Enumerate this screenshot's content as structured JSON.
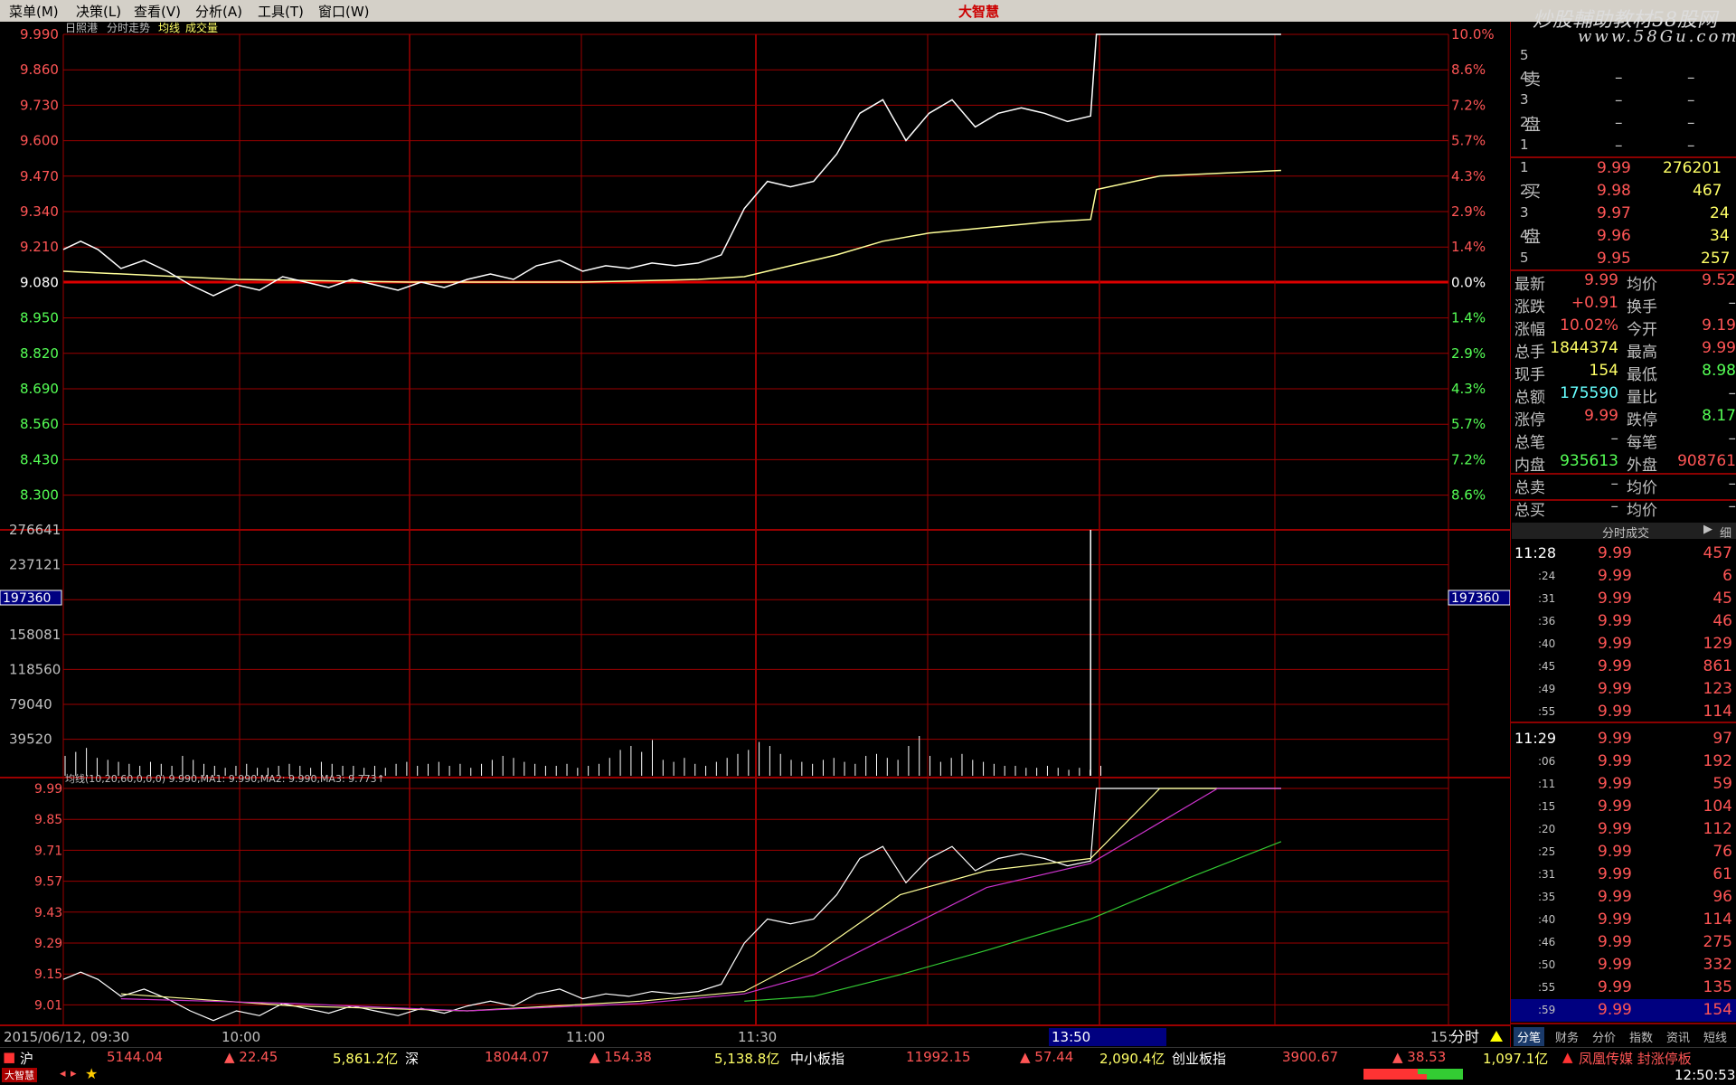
{
  "menu": {
    "items": [
      "菜单(M)",
      "决策(L)",
      "查看(V)",
      "分析(A)",
      "工具(T)",
      "窗口(W)"
    ],
    "logo": "大智慧"
  },
  "watermark": {
    "line1": "炒股輔助教材58股网",
    "line2": "www.58Gu.com"
  },
  "chart_header": {
    "stock": "日照港",
    "mode": "分时走势",
    "avg_label": "均线",
    "vol_label": "成交量"
  },
  "price_axis": {
    "left": [
      "9.990",
      "9.860",
      "9.730",
      "9.600",
      "9.470",
      "9.340",
      "9.210",
      "9.080",
      "8.950",
      "8.820",
      "8.690",
      "8.560",
      "8.430",
      "8.300"
    ],
    "right": [
      "10.0%",
      "8.6%",
      "7.2%",
      "5.7%",
      "4.3%",
      "2.9%",
      "1.4%",
      "0.0%",
      "1.4%",
      "2.9%",
      "4.3%",
      "5.7%",
      "7.2%",
      "8.6%"
    ]
  },
  "volume_axis": {
    "labels": [
      "276641",
      "237121",
      "197360",
      "158081",
      "118560",
      "79040",
      "39520"
    ],
    "cursor": "197360",
    "cursor_right": "197360"
  },
  "ma_panel": {
    "legend": "均线(10,20,60,0,0,0) 9.990,MA1: 9.990,MA2: 9.990,MA3: 9.773↑",
    "labels": [
      "9.99",
      "9.85",
      "9.71",
      "9.57",
      "9.43",
      "9.29",
      "9.15",
      "9.01"
    ]
  },
  "time_axis": {
    "date": "2015/06/12, 09:30",
    "t1": "10:00",
    "t2": "11:00",
    "t3": "11:30",
    "cursor": "13:50",
    "end": "15:",
    "mode": "分时"
  },
  "order_book": {
    "sell_label": [
      "卖",
      "盘"
    ],
    "buy_label": [
      "买",
      "盘"
    ],
    "sell": [
      {
        "lvl": "5",
        "p": "–",
        "v": "–"
      },
      {
        "lvl": "4",
        "p": "–",
        "v": "–"
      },
      {
        "lvl": "3",
        "p": "–",
        "v": "–"
      },
      {
        "lvl": "2",
        "p": "–",
        "v": "–"
      },
      {
        "lvl": "1",
        "p": "–",
        "v": "–"
      }
    ],
    "buy": [
      {
        "lvl": "1",
        "p": "9.99",
        "v": "276201"
      },
      {
        "lvl": "2",
        "p": "9.98",
        "v": "467"
      },
      {
        "lvl": "3",
        "p": "9.97",
        "v": "24"
      },
      {
        "lvl": "4",
        "p": "9.96",
        "v": "34"
      },
      {
        "lvl": "5",
        "p": "9.95",
        "v": "257"
      }
    ]
  },
  "quote": [
    {
      "k1": "最新",
      "v1": "9.99",
      "c1": "#ff5555",
      "k2": "均价",
      "v2": "9.52",
      "c2": "#ff5555"
    },
    {
      "k1": "涨跌",
      "v1": "+0.91",
      "c1": "#ff5555",
      "k2": "换手",
      "v2": "–",
      "c2": "#c0c0c0"
    },
    {
      "k1": "涨幅",
      "v1": "10.02%",
      "c1": "#ff5555",
      "k2": "今开",
      "v2": "9.19",
      "c2": "#ff5555"
    },
    {
      "k1": "总手",
      "v1": "1844374",
      "c1": "#ffff66",
      "k2": "最高",
      "v2": "9.99",
      "c2": "#ff5555"
    },
    {
      "k1": "现手",
      "v1": "154",
      "c1": "#ffff66",
      "k2": "最低",
      "v2": "8.98",
      "c2": "#55ff55"
    },
    {
      "k1": "总额",
      "v1": "175590",
      "c1": "#66ffff",
      "k2": "量比",
      "v2": "–",
      "c2": "#c0c0c0"
    },
    {
      "k1": "涨停",
      "v1": "9.99",
      "c1": "#ff5555",
      "k2": "跌停",
      "v2": "8.17",
      "c2": "#55ff55"
    },
    {
      "k1": "总笔",
      "v1": "–",
      "c1": "#c0c0c0",
      "k2": "每笔",
      "v2": "–",
      "c2": "#c0c0c0"
    },
    {
      "k1": "内盘",
      "v1": "935613",
      "c1": "#55ff55",
      "k2": "外盘",
      "v2": "908761",
      "c2": "#ff5555"
    },
    {
      "k1": "总卖",
      "v1": "–",
      "c1": "#c0c0c0",
      "k2": "均价",
      "v2": "–",
      "c2": "#c0c0c0"
    },
    {
      "k1": "总买",
      "v1": "–",
      "c1": "#c0c0c0",
      "k2": "均价",
      "v2": "–",
      "c2": "#c0c0c0"
    }
  ],
  "ticks_header": {
    "title": "分时成交",
    "btn": "细"
  },
  "ticks": [
    {
      "t": "11:28",
      "p": "9.99",
      "v": "457"
    },
    {
      "t": ":24",
      "p": "9.99",
      "v": "6"
    },
    {
      "t": ":31",
      "p": "9.99",
      "v": "45"
    },
    {
      "t": ":36",
      "p": "9.99",
      "v": "46"
    },
    {
      "t": ":40",
      "p": "9.99",
      "v": "129"
    },
    {
      "t": ":45",
      "p": "9.99",
      "v": "861"
    },
    {
      "t": ":49",
      "p": "9.99",
      "v": "123"
    },
    {
      "t": ":55",
      "p": "9.99",
      "v": "114"
    },
    {
      "t": "11:29",
      "p": "9.99",
      "v": "97"
    },
    {
      "t": ":06",
      "p": "9.99",
      "v": "192"
    },
    {
      "t": ":11",
      "p": "9.99",
      "v": "59"
    },
    {
      "t": ":15",
      "p": "9.99",
      "v": "104"
    },
    {
      "t": ":20",
      "p": "9.99",
      "v": "112"
    },
    {
      "t": ":25",
      "p": "9.99",
      "v": "76"
    },
    {
      "t": ":31",
      "p": "9.99",
      "v": "61"
    },
    {
      "t": ":35",
      "p": "9.99",
      "v": "96"
    },
    {
      "t": ":40",
      "p": "9.99",
      "v": "114"
    },
    {
      "t": ":46",
      "p": "9.99",
      "v": "275"
    },
    {
      "t": ":50",
      "p": "9.99",
      "v": "332"
    },
    {
      "t": ":55",
      "p": "9.99",
      "v": "135"
    },
    {
      "t": ":59",
      "p": "9.99",
      "v": "154"
    }
  ],
  "right_tabs": [
    "分笔",
    "财务",
    "分价",
    "指数",
    "资讯",
    "短线"
  ],
  "index_bar": {
    "sh_name": "沪",
    "sh_val": "5144.04",
    "sh_chg": "▲ 22.45",
    "sh_amt": "5,861.2亿",
    "sz_name": "深",
    "sz_val": "18044.07",
    "sz_chg": "▲ 154.38",
    "sz_amt": "5,138.8亿",
    "zx_name": "中小板指",
    "zx_val": "11992.15",
    "zx_chg": "▲ 57.44",
    "zx_amt": "2,090.4亿",
    "cy_name": "创业板指",
    "cy_val": "3900.67",
    "cy_chg": "▲ 38.53",
    "cy_amt": "1,097.1亿",
    "ticker": "凤凰传媒 封涨停板"
  },
  "status": {
    "logo": "大智慧",
    "clock": "12:50:53"
  },
  "chart_data": {
    "type": "line",
    "title": "日照港 分时走势",
    "y_range": [
      8.17,
      9.99
    ],
    "prev_close": 9.08,
    "price_series": [
      [
        0,
        9.2
      ],
      [
        3,
        9.23
      ],
      [
        6,
        9.2
      ],
      [
        10,
        9.13
      ],
      [
        14,
        9.16
      ],
      [
        18,
        9.12
      ],
      [
        22,
        9.07
      ],
      [
        26,
        9.03
      ],
      [
        30,
        9.07
      ],
      [
        34,
        9.05
      ],
      [
        38,
        9.1
      ],
      [
        42,
        9.08
      ],
      [
        46,
        9.06
      ],
      [
        50,
        9.09
      ],
      [
        54,
        9.07
      ],
      [
        58,
        9.05
      ],
      [
        62,
        9.08
      ],
      [
        66,
        9.06
      ],
      [
        70,
        9.09
      ],
      [
        74,
        9.11
      ],
      [
        78,
        9.09
      ],
      [
        82,
        9.14
      ],
      [
        86,
        9.16
      ],
      [
        90,
        9.12
      ],
      [
        94,
        9.14
      ],
      [
        98,
        9.13
      ],
      [
        102,
        9.15
      ],
      [
        106,
        9.14
      ],
      [
        110,
        9.15
      ],
      [
        114,
        9.18
      ],
      [
        118,
        9.35
      ],
      [
        122,
        9.45
      ],
      [
        126,
        9.43
      ],
      [
        130,
        9.45
      ],
      [
        134,
        9.55
      ],
      [
        138,
        9.7
      ],
      [
        142,
        9.75
      ],
      [
        146,
        9.6
      ],
      [
        150,
        9.7
      ],
      [
        154,
        9.75
      ],
      [
        158,
        9.65
      ],
      [
        162,
        9.7
      ],
      [
        166,
        9.72
      ],
      [
        170,
        9.7
      ],
      [
        174,
        9.67
      ],
      [
        178,
        9.69
      ],
      [
        179,
        9.99
      ],
      [
        211,
        9.99
      ]
    ],
    "avg_series": [
      [
        0,
        9.12
      ],
      [
        30,
        9.09
      ],
      [
        60,
        9.08
      ],
      [
        90,
        9.08
      ],
      [
        110,
        9.09
      ],
      [
        118,
        9.1
      ],
      [
        126,
        9.14
      ],
      [
        134,
        9.18
      ],
      [
        142,
        9.23
      ],
      [
        150,
        9.26
      ],
      [
        160,
        9.28
      ],
      [
        170,
        9.3
      ],
      [
        178,
        9.31
      ],
      [
        179,
        9.42
      ],
      [
        190,
        9.47
      ],
      [
        211,
        9.49
      ]
    ],
    "volume_series": [
      {
        "name": "成交量",
        "spike": [
          178,
          276641
        ]
      }
    ]
  }
}
